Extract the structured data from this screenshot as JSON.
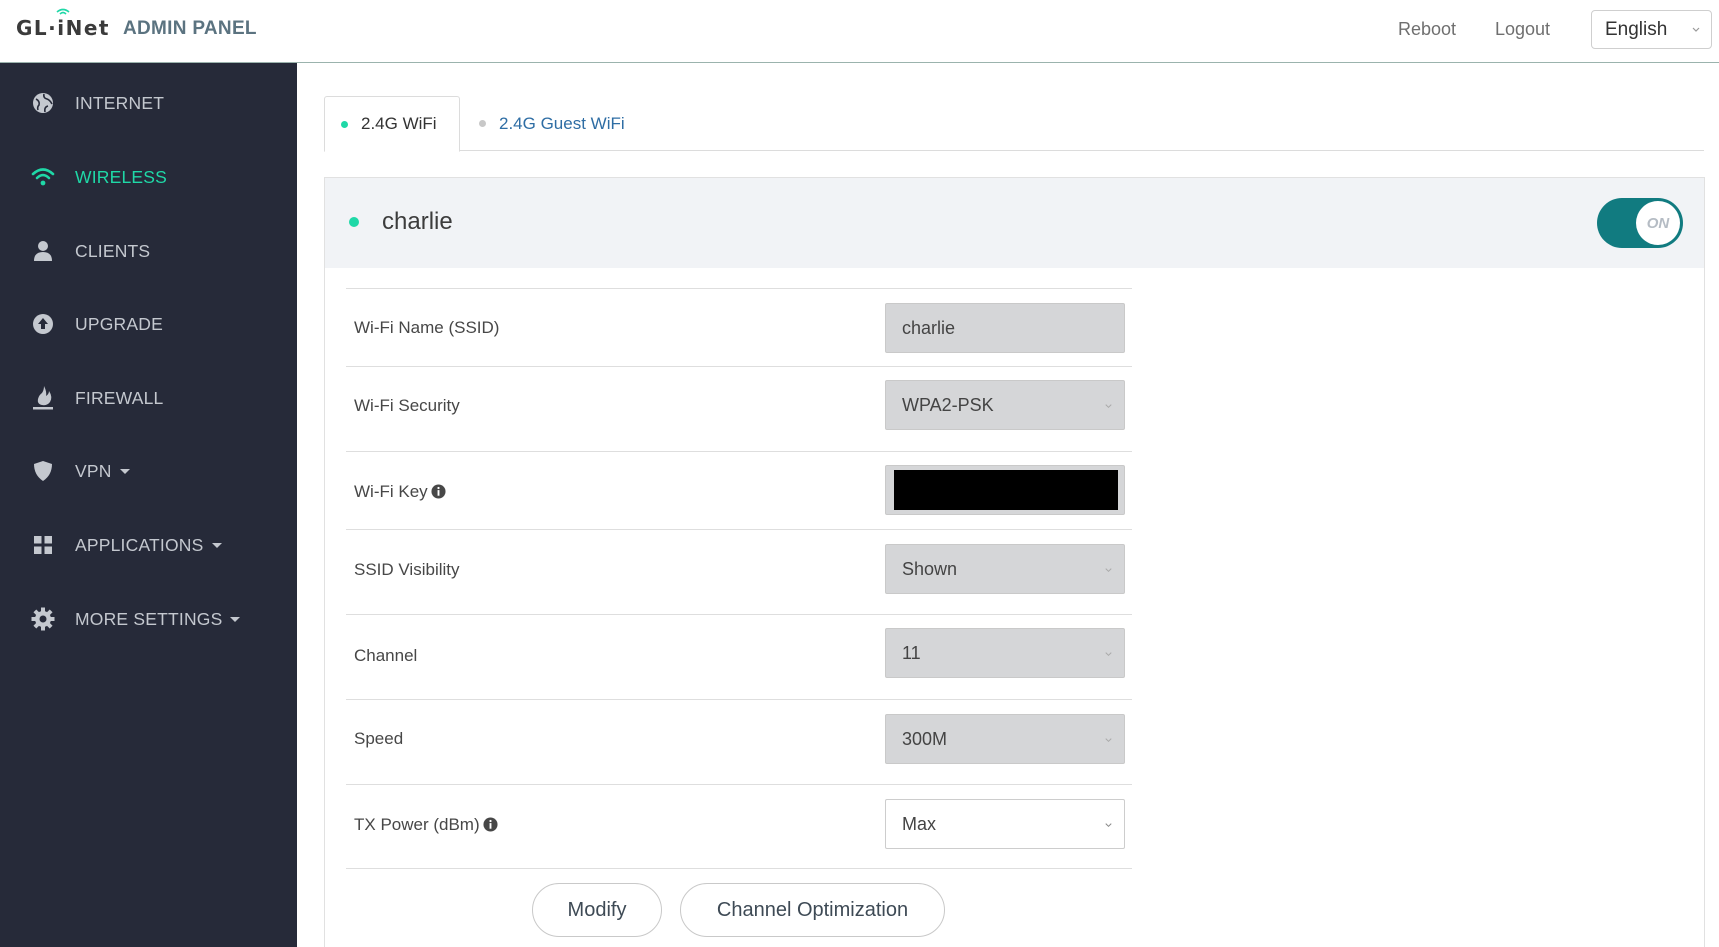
{
  "header": {
    "logo": "GL·iNet",
    "title": "ADMIN PANEL",
    "reboot_label": "Reboot",
    "logout_label": "Logout",
    "language": "English"
  },
  "sidebar": {
    "items": [
      {
        "label": "INTERNET",
        "icon": "globe-icon"
      },
      {
        "label": "WIRELESS",
        "icon": "wifi-icon",
        "active": true
      },
      {
        "label": "CLIENTS",
        "icon": "user-icon"
      },
      {
        "label": "UPGRADE",
        "icon": "upload-icon"
      },
      {
        "label": "FIREWALL",
        "icon": "flame-icon"
      },
      {
        "label": "VPN",
        "icon": "shield-icon",
        "dropdown": true
      },
      {
        "label": "APPLICATIONS",
        "icon": "grid-icon",
        "dropdown": true
      },
      {
        "label": "MORE SETTINGS",
        "icon": "gear-icon",
        "dropdown": true
      }
    ]
  },
  "tabs": [
    {
      "label": "2.4G WiFi",
      "active": true
    },
    {
      "label": "2.4G Guest WiFi",
      "active": false
    }
  ],
  "panel": {
    "ssid_name": "charlie",
    "toggle_label": "ON",
    "toggle_on": true,
    "rows": {
      "ssid": {
        "label": "Wi-Fi Name (SSID)",
        "value": "charlie"
      },
      "security": {
        "label": "Wi-Fi Security",
        "value": "WPA2-PSK"
      },
      "key": {
        "label": "Wi-Fi Key",
        "value": ""
      },
      "visibility": {
        "label": "SSID Visibility",
        "value": "Shown"
      },
      "channel": {
        "label": "Channel",
        "value": "11"
      },
      "speed": {
        "label": "Speed",
        "value": "300M"
      },
      "txpower": {
        "label": "TX Power (dBm)",
        "value": "Max"
      }
    },
    "modify_label": "Modify",
    "channel_opt_label": "Channel Optimization"
  },
  "colors": {
    "accent": "#1fd8a7",
    "sidebar_bg": "#262a39",
    "toggle_on": "#117b80",
    "link": "#2e6da4"
  }
}
